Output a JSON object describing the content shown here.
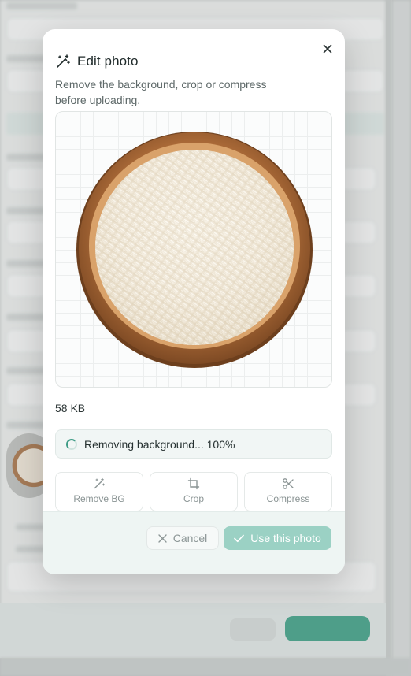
{
  "modal": {
    "title": "Edit photo",
    "subtitle": "Remove the background, crop or compress before uploading.",
    "file_size": "58 KB",
    "progress_text": "Removing background... 100%",
    "progress": 1.0,
    "tools": [
      {
        "label": "Remove BG",
        "icon": "magic-wand-icon"
      },
      {
        "label": "Crop",
        "icon": "crop-icon"
      },
      {
        "label": "Compress",
        "icon": "scissors-icon"
      }
    ],
    "cancel_label": "Cancel",
    "use_label": "Use this photo",
    "title_icon": "magic-wand-icon",
    "close_icon": "close-icon"
  },
  "colors": {
    "accent": "#3e9c86",
    "accent_disabled": "#9bd1c4",
    "background_primary_button": "#3f9f86"
  }
}
